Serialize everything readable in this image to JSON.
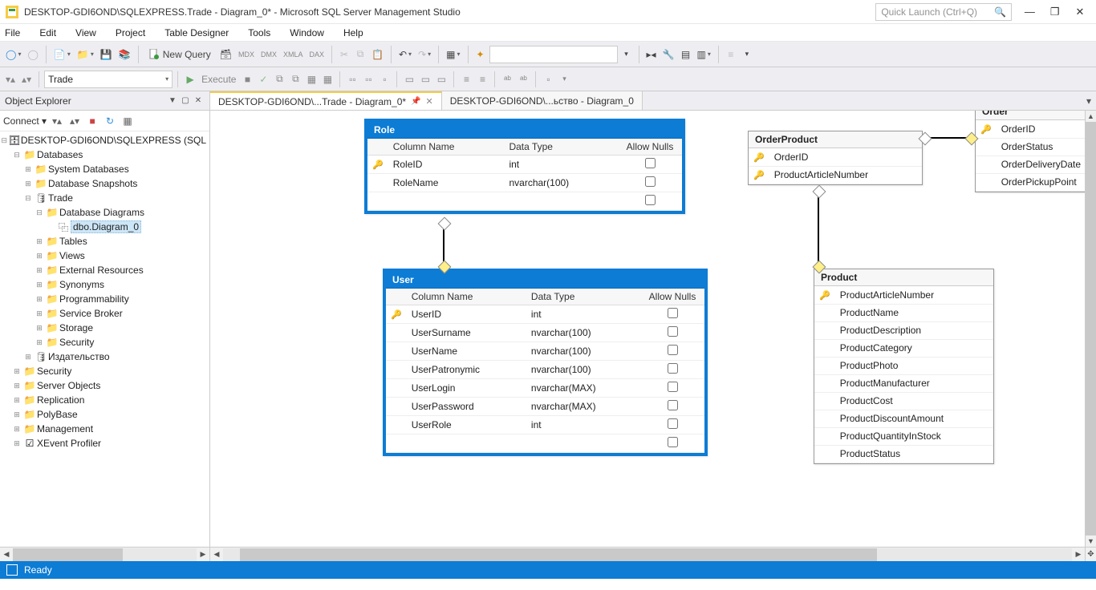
{
  "window": {
    "title": "DESKTOP-GDI6OND\\SQLEXPRESS.Trade - Diagram_0* - Microsoft SQL Server Management Studio",
    "quicklaunch_placeholder": "Quick Launch (Ctrl+Q)"
  },
  "menu": [
    "File",
    "Edit",
    "View",
    "Project",
    "Table Designer",
    "Tools",
    "Window",
    "Help"
  ],
  "toolbar": {
    "newquery": "New Query",
    "execute": "Execute",
    "combo2_value": "Trade"
  },
  "objexp": {
    "title": "Object Explorer",
    "connect": "Connect",
    "server": "DESKTOP-GDI6OND\\SQLEXPRESS (SQL",
    "databases": "Databases",
    "sysdb": "System Databases",
    "snap": "Database Snapshots",
    "trade": "Trade",
    "dbdiag": "Database Diagrams",
    "dbo_diag": "dbo.Diagram_0",
    "tables": "Tables",
    "views": "Views",
    "extres": "External Resources",
    "syn": "Synonyms",
    "prog": "Programmability",
    "sbroker": "Service Broker",
    "storage": "Storage",
    "security": "Security",
    "izdat": "Издательство",
    "security2": "Security",
    "srvobj": "Server Objects",
    "repl": "Replication",
    "polybase": "PolyBase",
    "mgmt": "Management",
    "xevent": "XEvent Profiler"
  },
  "tabs": {
    "active": "DESKTOP-GDI6OND\\...Trade - Diagram_0*",
    "inactive": "DESKTOP-GDI6OND\\...ьство - Diagram_0"
  },
  "diagram": {
    "role": {
      "title": "Role",
      "headers": [
        "Column Name",
        "Data Type",
        "Allow Nulls"
      ],
      "rows": [
        {
          "key": true,
          "name": "RoleID",
          "type": "int",
          "nulls": false
        },
        {
          "key": false,
          "name": "RoleName",
          "type": "nvarchar(100)",
          "nulls": false
        }
      ]
    },
    "user": {
      "title": "User",
      "headers": [
        "Column Name",
        "Data Type",
        "Allow Nulls"
      ],
      "rows": [
        {
          "key": true,
          "name": "UserID",
          "type": "int",
          "nulls": false
        },
        {
          "key": false,
          "name": "UserSurname",
          "type": "nvarchar(100)",
          "nulls": false
        },
        {
          "key": false,
          "name": "UserName",
          "type": "nvarchar(100)",
          "nulls": false
        },
        {
          "key": false,
          "name": "UserPatronymic",
          "type": "nvarchar(100)",
          "nulls": false
        },
        {
          "key": false,
          "name": "UserLogin",
          "type": "nvarchar(MAX)",
          "nulls": false
        },
        {
          "key": false,
          "name": "UserPassword",
          "type": "nvarchar(MAX)",
          "nulls": false
        },
        {
          "key": false,
          "name": "UserRole",
          "type": "int",
          "nulls": false
        }
      ]
    },
    "orderproduct": {
      "title": "OrderProduct",
      "rows": [
        {
          "key": true,
          "name": "OrderID"
        },
        {
          "key": true,
          "name": "ProductArticleNumber"
        }
      ]
    },
    "product": {
      "title": "Product",
      "rows": [
        {
          "key": true,
          "name": "ProductArticleNumber"
        },
        {
          "key": false,
          "name": "ProductName"
        },
        {
          "key": false,
          "name": "ProductDescription"
        },
        {
          "key": false,
          "name": "ProductCategory"
        },
        {
          "key": false,
          "name": "ProductPhoto"
        },
        {
          "key": false,
          "name": "ProductManufacturer"
        },
        {
          "key": false,
          "name": "ProductCost"
        },
        {
          "key": false,
          "name": "ProductDiscountAmount"
        },
        {
          "key": false,
          "name": "ProductQuantityInStock"
        },
        {
          "key": false,
          "name": "ProductStatus"
        }
      ]
    },
    "order": {
      "title": "Order",
      "rows": [
        {
          "key": true,
          "name": "OrderID"
        },
        {
          "key": false,
          "name": "OrderStatus"
        },
        {
          "key": false,
          "name": "OrderDeliveryDate"
        },
        {
          "key": false,
          "name": "OrderPickupPoint"
        }
      ]
    }
  },
  "status": "Ready"
}
